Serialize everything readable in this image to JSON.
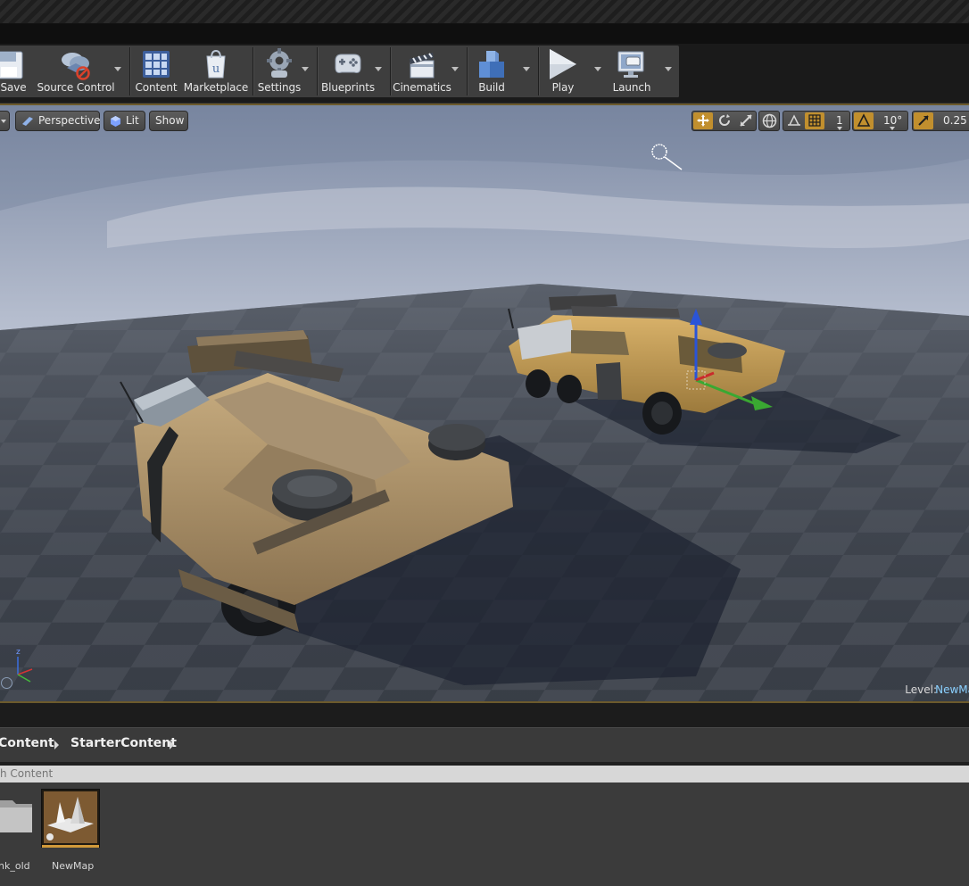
{
  "colors": {
    "accent": "#c18f2e",
    "level_name": "#8ad0ff",
    "viewport_border": "#6c5a2c"
  },
  "toolbar": {
    "buttons": [
      {
        "id": "save",
        "label": "Save",
        "icon": "save-icon"
      },
      {
        "id": "source-control",
        "label": "Source Control",
        "icon": "source-control-icon",
        "dropdown": true
      },
      {
        "id": "content",
        "label": "Content",
        "icon": "content-icon"
      },
      {
        "id": "marketplace",
        "label": "Marketplace",
        "icon": "marketplace-icon"
      },
      {
        "id": "settings",
        "label": "Settings",
        "icon": "settings-icon",
        "dropdown": true
      },
      {
        "id": "blueprints",
        "label": "Blueprints",
        "icon": "blueprints-icon",
        "dropdown": true
      },
      {
        "id": "cinematics",
        "label": "Cinematics",
        "icon": "cinematics-icon",
        "dropdown": true
      },
      {
        "id": "build",
        "label": "Build",
        "icon": "build-icon",
        "dropdown": true
      },
      {
        "id": "play",
        "label": "Play",
        "icon": "play-icon",
        "dropdown": true
      },
      {
        "id": "launch",
        "label": "Launch",
        "icon": "launch-icon",
        "dropdown": true
      }
    ]
  },
  "viewport": {
    "view_mode": "Perspective",
    "lighting": "Lit",
    "show": "Show",
    "grid_snap_value": "1",
    "rotation_snap_value": "10°",
    "scale_snap_value": "0.25",
    "level_label": "Level:",
    "level_name": "NewMa",
    "axis_label": "z"
  },
  "content_browser": {
    "breadcrumbs": [
      "Content",
      "StarterContent"
    ],
    "search_placeholder": "h Content",
    "assets": [
      {
        "label": "nk_old",
        "type": "folder-icon"
      },
      {
        "label": "NewMap",
        "type": "map-icon"
      }
    ]
  }
}
